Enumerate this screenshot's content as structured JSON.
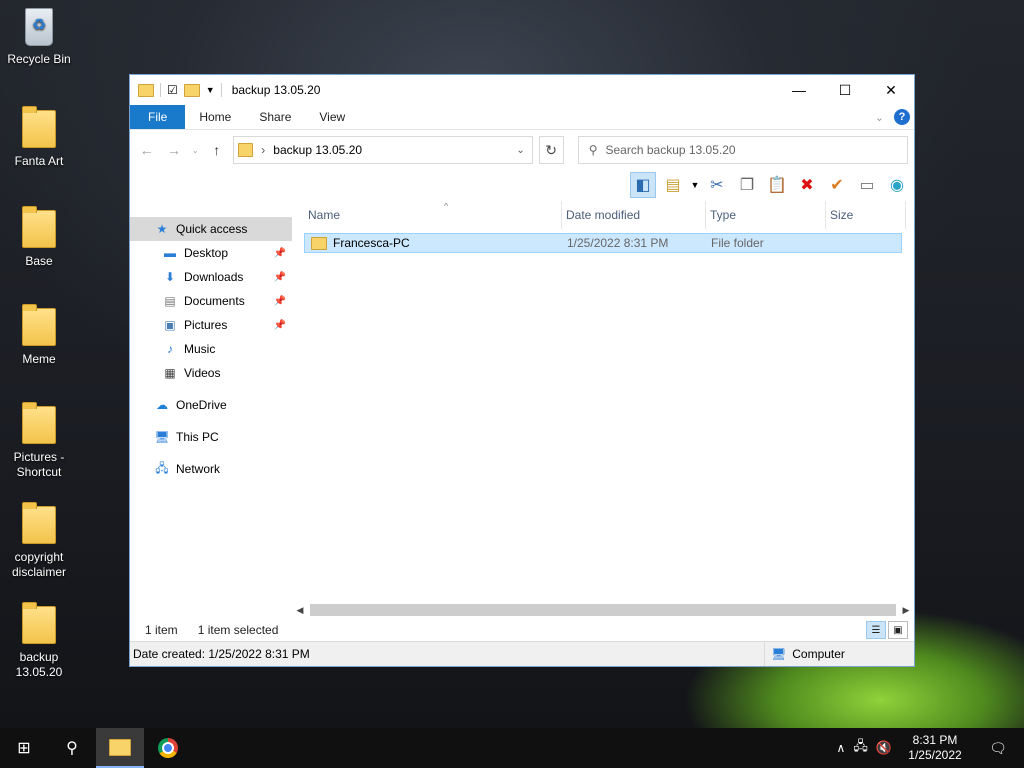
{
  "desktop": {
    "icons": [
      {
        "label": "Recycle Bin",
        "icon": "recycle-bin-icon"
      },
      {
        "label": "Fanta Art",
        "icon": "folder-icon"
      },
      {
        "label": "Base",
        "icon": "folder-icon"
      },
      {
        "label": "Meme",
        "icon": "folder-icon"
      },
      {
        "label": "Pictures - Shortcut",
        "icon": "folder-shortcut-icon"
      },
      {
        "label": "copyright disclaimer",
        "icon": "folder-icon"
      },
      {
        "label": "backup 13.05.20",
        "icon": "folder-icon"
      }
    ]
  },
  "window": {
    "title": "backup 13.05.20",
    "controls": {
      "minimize": "—",
      "maximize": "☐",
      "close": "✕"
    },
    "ribbon_tabs": [
      "File",
      "Home",
      "Share",
      "View"
    ],
    "help": "?",
    "address": {
      "path": "backup 13.05.20",
      "separator": "›"
    },
    "search": {
      "placeholder": "Search backup 13.05.20"
    },
    "nav": {
      "quick_access": "Quick access",
      "items": [
        "Desktop",
        "Downloads",
        "Documents",
        "Pictures",
        "Music",
        "Videos"
      ],
      "onedrive": "OneDrive",
      "this_pc": "This PC",
      "network": "Network"
    },
    "columns": [
      "Name",
      "Date modified",
      "Type",
      "Size"
    ],
    "rows": [
      {
        "name": "Francesca-PC",
        "date": "1/25/2022 8:31 PM",
        "type": "File folder",
        "size": ""
      }
    ],
    "status": {
      "count": "1 item",
      "selected": "1 item selected"
    },
    "details": {
      "created": "Date created: 1/25/2022 8:31 PM",
      "location": "Computer"
    }
  },
  "taskbar": {
    "time": "8:31 PM",
    "date": "1/25/2022"
  }
}
